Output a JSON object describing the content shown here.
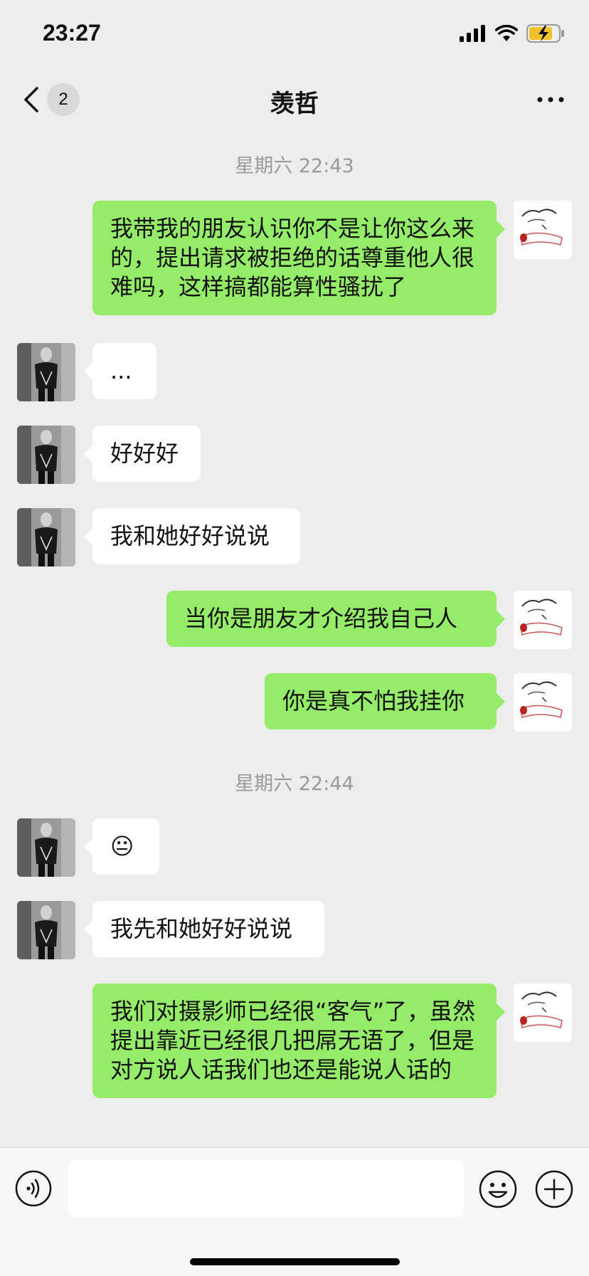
{
  "status_bar": {
    "time": "23:27",
    "icons": [
      "signal-icon",
      "wifi-icon",
      "battery-charging-icon"
    ],
    "battery_color": "#f2c12e"
  },
  "nav": {
    "back_icon": "chevron-left-icon",
    "unread_count": "2",
    "title": "羡哲",
    "more_icon": "ellipsis-icon"
  },
  "timestamps": [
    "星期六 22:43",
    "星期六 22:44"
  ],
  "messages": [
    {
      "side": "out",
      "text": "我带我的朋友认识你不是让你这么来的，提出请求被拒绝的话尊重他人很难吗，这样搞都能算性骚扰了"
    },
    {
      "side": "in",
      "text": "..."
    },
    {
      "side": "in",
      "text": "好好好"
    },
    {
      "side": "in",
      "text": "我和她好好说说"
    },
    {
      "side": "out",
      "text": "当你是朋友才介绍我自己人"
    },
    {
      "side": "out",
      "text": "你是真不怕我挂你"
    },
    {
      "side": "in",
      "text": "😐"
    },
    {
      "side": "in",
      "text": "我先和她好好说说"
    },
    {
      "side": "out",
      "text": "我们对摄影师已经很“客气”了，虽然提出靠近已经很几把屌无语了，但是对方说人话我们也还是能说人话的"
    }
  ],
  "input_bar": {
    "voice_icon": "voice-icon",
    "input_value": "",
    "emoji_icon": "smiley-icon",
    "plus_icon": "plus-circle-icon"
  },
  "colors": {
    "outgoing_bubble": "#95ec69",
    "incoming_bubble": "#ffffff",
    "chat_background": "#ededed"
  }
}
